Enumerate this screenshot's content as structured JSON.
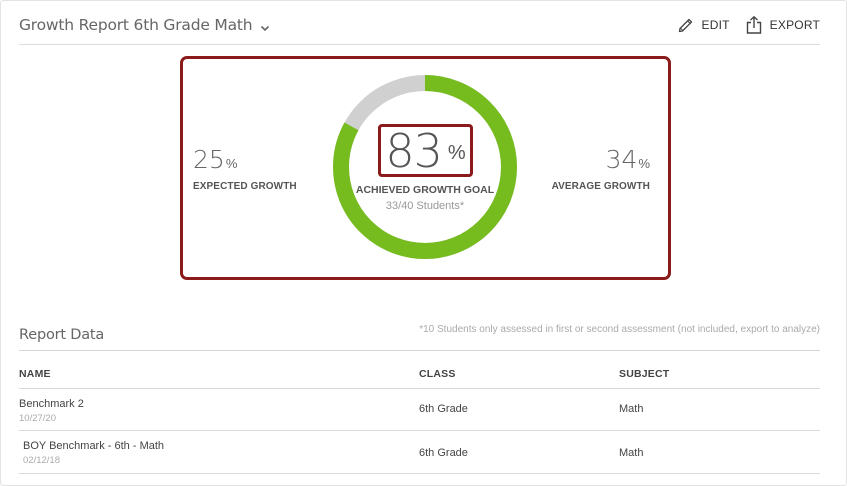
{
  "header": {
    "title": "Growth Report 6th Grade Math",
    "edit_label": "EDIT",
    "export_label": "EXPORT"
  },
  "summary": {
    "expected_growth": {
      "value": "25",
      "unit": "%",
      "label": "EXPECTED GROWTH"
    },
    "achieved": {
      "value": "83",
      "unit": "%",
      "label": "ACHIEVED GROWTH GOAL",
      "sub": "33/40 Students*",
      "fraction": 0.83
    },
    "average_growth": {
      "value": "34",
      "unit": "%",
      "label": "AVERAGE GROWTH"
    }
  },
  "report": {
    "title": "Report Data",
    "note": "*10 Students only assessed in first or second assessment (not included, export to analyze)",
    "columns": [
      "NAME",
      "CLASS",
      "SUBJECT"
    ],
    "rows": [
      {
        "name": "Benchmark 2",
        "date": "10/27/20",
        "class": "6th Grade",
        "subject": "Math"
      },
      {
        "name": "BOY Benchmark - 6th - Math",
        "date": "02/12/18",
        "class": "6th Grade",
        "subject": "Math"
      }
    ]
  },
  "colors": {
    "accent_green": "#77bc1f",
    "track_gray": "#d0d0d0",
    "highlight_red": "#8b1a1a"
  },
  "icons": {
    "title_dropdown": "chevron-down-icon",
    "edit": "pencil-icon",
    "export": "share-export-icon"
  }
}
